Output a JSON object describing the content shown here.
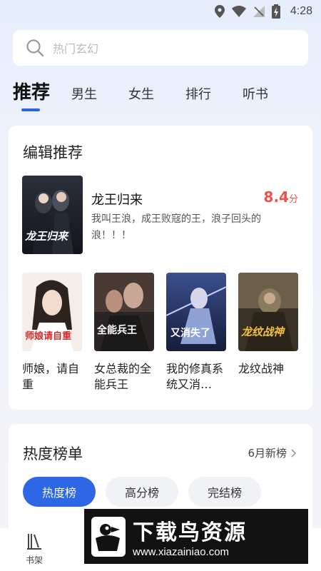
{
  "status_bar": {
    "time": "4:28"
  },
  "search": {
    "placeholder": "热门玄幻"
  },
  "tabs": [
    {
      "label": "推荐",
      "active": true
    },
    {
      "label": "男生"
    },
    {
      "label": "女生"
    },
    {
      "label": "排行"
    },
    {
      "label": "听书"
    }
  ],
  "editor_section": {
    "title": "编辑推荐",
    "featured": {
      "title": "龙王归来",
      "score": "8.4",
      "score_unit": "分",
      "description": "我叫王浪，成王败寇的王，浪子回头的浪！！！",
      "cover_text": "龙王归来"
    },
    "books": [
      {
        "title": "师娘，请自重",
        "cover_text": "师娘请自重"
      },
      {
        "title": "女总裁的全能兵王",
        "cover_text": "全能兵王"
      },
      {
        "title": "我的修真系统又消…",
        "cover_text": "又消失了"
      },
      {
        "title": "龙纹战神",
        "cover_text": "龙纹战神"
      }
    ]
  },
  "hot_section": {
    "title": "热度榜单",
    "more_label": "6月新榜",
    "chips": [
      {
        "label": "热度榜",
        "active": true
      },
      {
        "label": "高分榜"
      },
      {
        "label": "完结榜"
      }
    ]
  },
  "bottom_nav": {
    "shelf_label": "书架"
  },
  "watermark": {
    "brand": "下载鸟资源",
    "url": "www.xiazainiao.com"
  },
  "colors": {
    "accent": "#2d67e6",
    "score": "#ee4f4f"
  }
}
